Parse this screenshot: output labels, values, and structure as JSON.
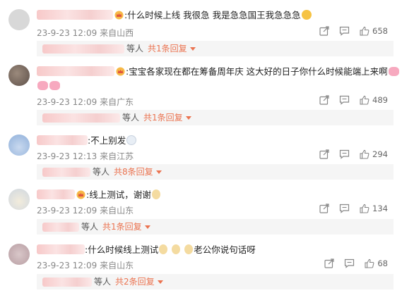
{
  "comments": [
    {
      "text": ":什么时候上线 我很急 我是急急国王我急急急",
      "time": "23-9-23 12:09",
      "location": "来自山西",
      "likes": "658",
      "reply_who": "等人",
      "reply_count": "共1条回复"
    },
    {
      "text": ":宝宝各家现在都在筹备周年庆  这大好的日子你什么时候能端上来啊",
      "time": "23-9-23 12:09",
      "location": "来自广东",
      "likes": "489",
      "reply_who": "等人",
      "reply_count": "共1条回复"
    },
    {
      "text": ":不上别发",
      "time": "23-9-23 12:13",
      "location": "来自江苏",
      "likes": "294",
      "reply_who": "等人",
      "reply_count": "共8条回复"
    },
    {
      "text": ":线上测试，谢谢",
      "time": "23-9-23 12:09",
      "location": "来自山东",
      "likes": "134",
      "reply_who": "等人",
      "reply_count": "共1条回复"
    },
    {
      "text_a": ":什么时候线上测试",
      "text_b": "老公你说句话呀",
      "time": "23-9-23 12:09",
      "location": "来自山东",
      "likes": "68",
      "reply_who": "等人",
      "reply_count": "共2条回复"
    }
  ],
  "icons": {
    "share": "share-icon",
    "comment": "comment-icon",
    "like": "thumbs-up-icon",
    "crown": "crown-badge-icon"
  },
  "colors": {
    "accent": "#eb7350",
    "meta": "#888888",
    "reply_bg": "#f5f5f5"
  }
}
